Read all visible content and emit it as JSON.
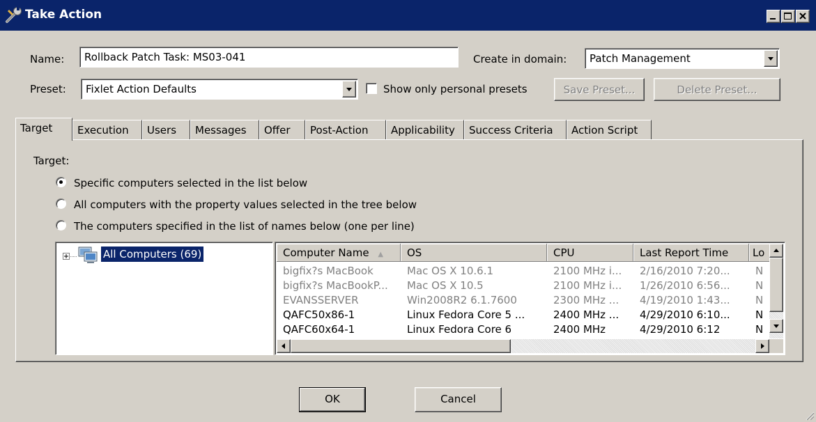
{
  "window": {
    "title": "Take Action",
    "icon": "wrench-icon"
  },
  "form": {
    "name_label": "Name:",
    "name_value": "Rollback Patch Task: MS03-041",
    "domain_label": "Create in domain:",
    "domain_value": "Patch Management",
    "preset_label": "Preset:",
    "preset_value": "Fixlet Action Defaults",
    "personal_presets_label": "Show only personal presets",
    "personal_presets_checked": false,
    "save_preset_label": "Save Preset...",
    "delete_preset_label": "Delete Preset..."
  },
  "tabs": [
    {
      "label": "Target",
      "active": true
    },
    {
      "label": "Execution"
    },
    {
      "label": "Users"
    },
    {
      "label": "Messages"
    },
    {
      "label": "Offer"
    },
    {
      "label": "Post-Action"
    },
    {
      "label": "Applicability"
    },
    {
      "label": "Success Criteria"
    },
    {
      "label": "Action Script"
    }
  ],
  "target": {
    "heading": "Target:",
    "options": [
      {
        "label": "Specific computers selected in the list below",
        "checked": true
      },
      {
        "label": "All computers with the property values selected in the tree below",
        "checked": false
      },
      {
        "label": "The computers specified in the list of names below (one per line)",
        "checked": false
      }
    ],
    "tree_root": "All Computers (69)"
  },
  "computer_list": {
    "columns": [
      "Computer Name",
      "OS",
      "CPU",
      "Last Report Time",
      "Lo"
    ],
    "sort_indicator": "▲",
    "rows": [
      {
        "name": "bigfix?s MacBook",
        "os": "Mac OS X 10.6.1",
        "cpu": "2100 MHz i...",
        "last_report": "2/16/2010 7:20...",
        "lo": "N",
        "disabled": true
      },
      {
        "name": "bigfix?s MacBookP...",
        "os": "Mac OS X 10.5",
        "cpu": "2100 MHz i...",
        "last_report": "1/26/2010 6:56...",
        "lo": "N",
        "disabled": true
      },
      {
        "name": "EVANSSERVER",
        "os": "Win2008R2 6.1.7600",
        "cpu": "2300 MHz ...",
        "last_report": "4/19/2010 1:43...",
        "lo": "N",
        "disabled": true
      },
      {
        "name": "QAFC50x86-1",
        "os": "Linux Fedora Core 5 ...",
        "cpu": "2400 MHz ...",
        "last_report": "4/29/2010 6:10...",
        "lo": "N",
        "disabled": false
      },
      {
        "name": "QAFC60x64-1",
        "os": "Linux Fedora Core 6",
        "cpu": "2400 MHz",
        "last_report": "4/29/2010 6:12",
        "lo": "N",
        "disabled": false
      }
    ]
  },
  "footer": {
    "ok_label": "OK",
    "cancel_label": "Cancel"
  },
  "colors": {
    "titlebar": "#0a246a",
    "window_bg": "#d4d0c8",
    "selection": "#0a246a"
  }
}
